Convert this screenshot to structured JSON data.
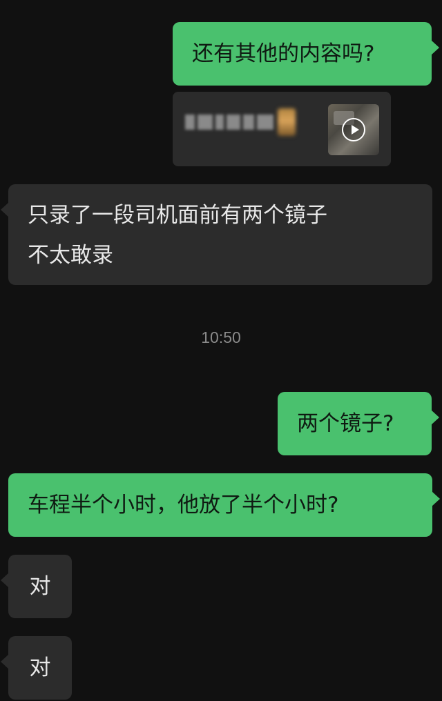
{
  "messages": [
    {
      "side": "sent",
      "text": "还有其他的内容吗?"
    },
    {
      "side": "sent",
      "type": "video-card"
    },
    {
      "side": "received",
      "lines": [
        "只录了一段司机面前有两个镜子",
        "不太敢录"
      ]
    },
    {
      "side": "sent",
      "text": "两个镜子?"
    },
    {
      "side": "sent",
      "text": "车程半个小时，他放了半个小时?"
    },
    {
      "side": "received",
      "text": "对"
    },
    {
      "side": "received",
      "text": "对"
    }
  ],
  "timestamp": "10:50",
  "colors": {
    "background": "#111111",
    "sent_bubble": "#4ac16e",
    "received_bubble": "#2c2c2c"
  }
}
